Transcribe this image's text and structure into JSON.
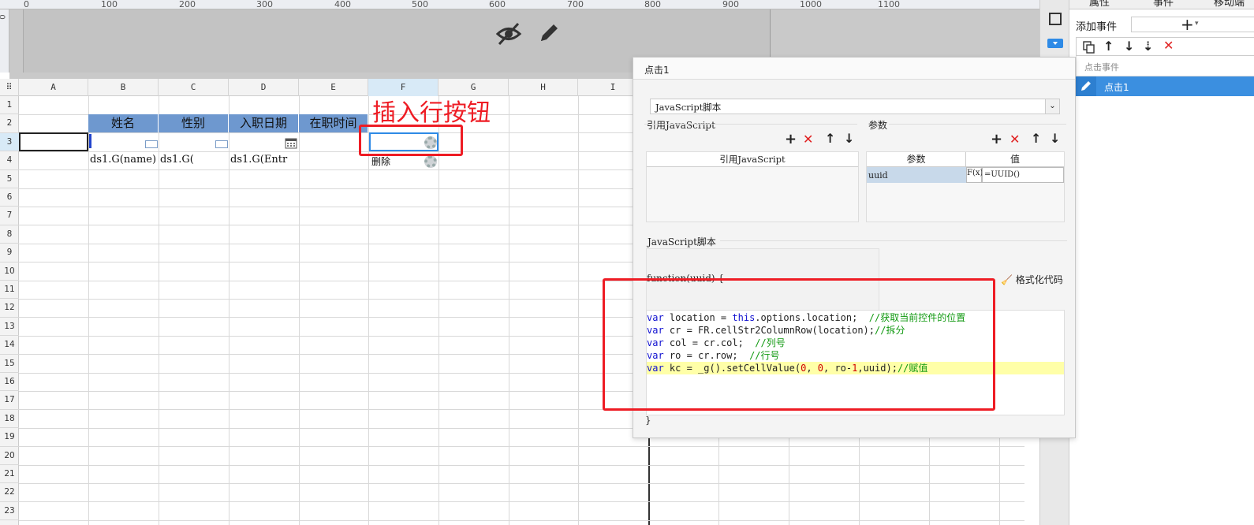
{
  "ruler": {
    "labels": [
      "0",
      "100",
      "200",
      "300",
      "400",
      "500",
      "600",
      "700",
      "800",
      "900",
      "1000",
      "1100"
    ],
    "vertical_label": "0"
  },
  "columns": [
    "A",
    "B",
    "C",
    "D",
    "E",
    "F",
    "G",
    "H",
    "I"
  ],
  "rows": [
    "1",
    "2",
    "3",
    "4",
    "5",
    "6",
    "7",
    "8",
    "9",
    "10",
    "11",
    "12",
    "13",
    "14",
    "15",
    "16",
    "17",
    "18",
    "19",
    "20",
    "21",
    "22",
    "23"
  ],
  "sheet": {
    "headers": [
      "姓名",
      "性别",
      "入职日期",
      "在职时间"
    ],
    "row4": [
      "ds1.G(name)",
      "ds1.G(",
      "ds1.G(Entr"
    ],
    "delete_label": "删除",
    "annotation": "插入行按钮"
  },
  "right_panel": {
    "tabs": [
      "属性",
      "事件",
      "移动端"
    ],
    "add_event_label": "添加事件",
    "add_icon": "plus-icon",
    "section_title": "点击事件",
    "event_item": "点击1"
  },
  "dialog": {
    "title": "点击1",
    "type_select": "JavaScript脚本",
    "ref_js_label": "引用JavaScript",
    "ref_js_header": "引用JavaScript",
    "params_label": "参数",
    "params_header_name": "参数",
    "params_header_value": "值",
    "param_name": "uuid",
    "param_value": "=UUID()",
    "param_formula_icon": "F(x)",
    "script_label": "JavaScript脚本",
    "function_header": "function(uuid) {",
    "format_code_label": "格式化代码",
    "closing_brace": "}",
    "code_lines": [
      {
        "kw": "var",
        "rest": " location = ",
        "kw2": "this",
        "rest2": ".options.location;  ",
        "comment": "//获取当前控件的位置"
      },
      {
        "kw": "var",
        "rest": " cr = FR.cellStr2ColumnRow(location);",
        "kw2": "",
        "rest2": "",
        "comment": "//拆分"
      },
      {
        "kw": "var",
        "rest": " col = cr.col;  ",
        "kw2": "",
        "rest2": "",
        "comment": "//列号"
      },
      {
        "kw": "var",
        "rest": " ro = cr.row;  ",
        "kw2": "",
        "rest2": "",
        "comment": "//行号"
      }
    ],
    "code_last": {
      "kw": "var",
      "a": " kc = _g().setCellValue(",
      "n1": "0",
      "b": ", ",
      "n2": "0",
      "c": ", ro-",
      "n3": "1",
      "d": ",uuid);",
      "comment": "//赋值"
    }
  },
  "colors": {
    "accent": "#2e8ae6",
    "header_fill": "#6e98cf",
    "annotation": "#ee1c24",
    "selected_tab": "#3b8fe0"
  }
}
